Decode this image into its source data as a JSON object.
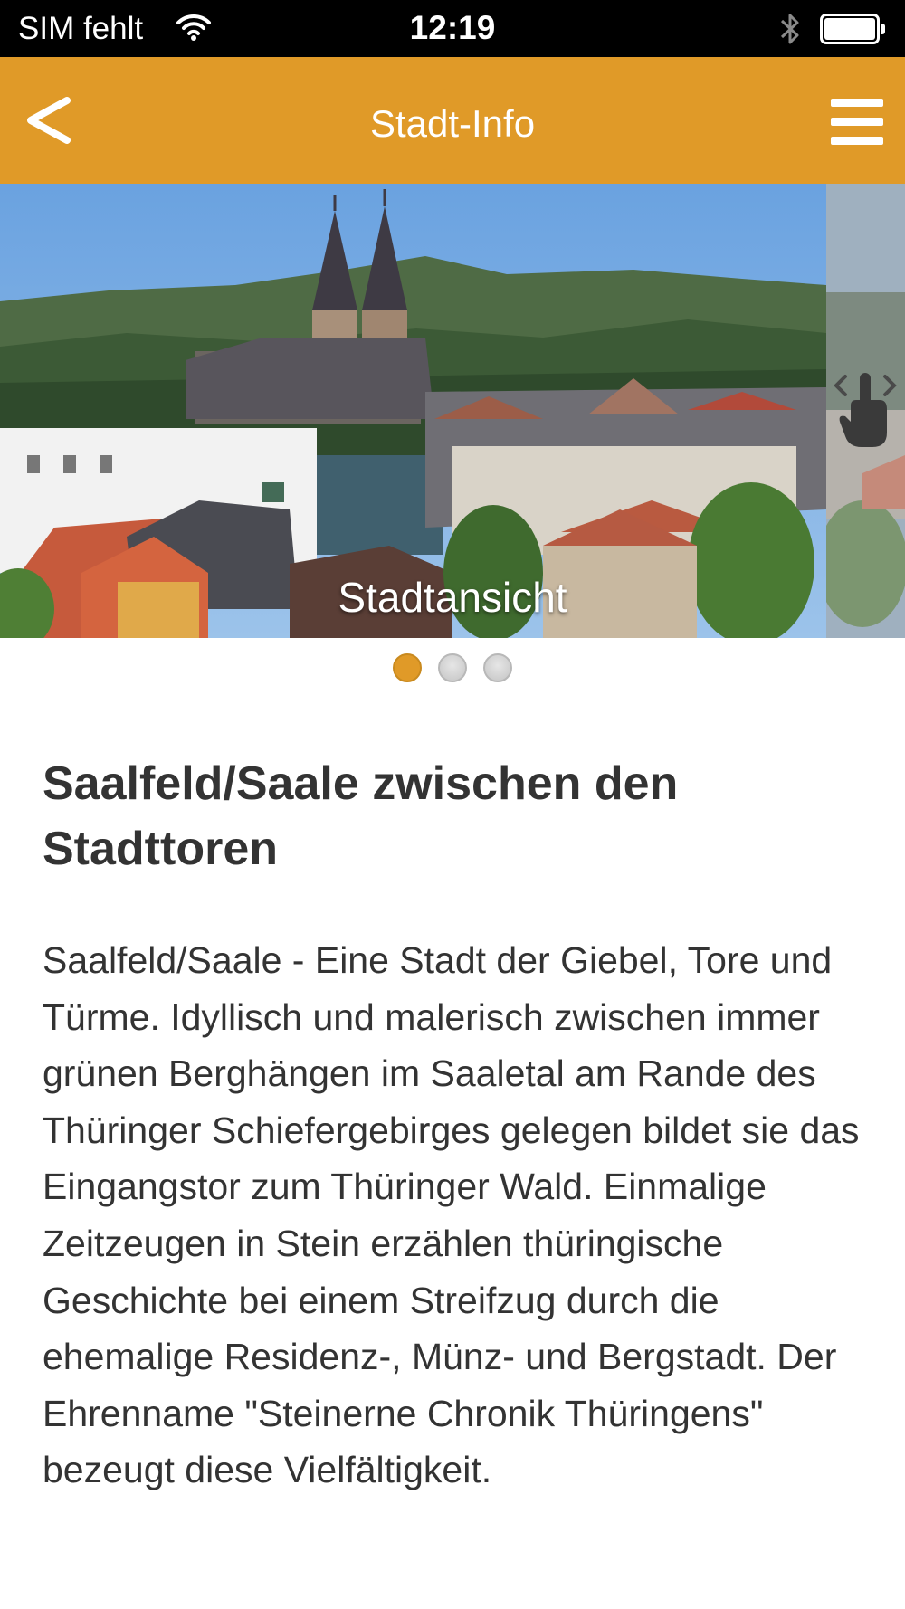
{
  "status_bar": {
    "carrier": "SIM fehlt",
    "time": "12:19",
    "icons": [
      "wifi-icon",
      "bluetooth-icon",
      "battery-icon"
    ]
  },
  "nav": {
    "title": "Stadt-Info",
    "back_icon": "chevron-left-icon",
    "menu_icon": "hamburger-menu-icon",
    "accent_color": "#e09a28"
  },
  "slider": {
    "caption": "Stadtansicht",
    "slide_count": 3,
    "active_index": 0,
    "swipe_hint_icon": "swipe-hand-icon"
  },
  "content": {
    "title": "Saalfeld/Saale zwischen den Stadttoren",
    "body": "Saalfeld/Saale - Eine Stadt der Giebel, Tore und Türme. Idyllisch und malerisch zwischen immer grünen Berghängen im Saaletal am Rande des Thüringer Schiefergebirges gelegen bildet sie das Eingangstor zum Thüringer Wald. Einmalige Zeitzeugen in Stein erzählen thüringische Geschichte bei einem Streifzug durch die ehemalige Residenz-, Münz- und Bergstadt. Der Ehrenname \"Steinerne Chronik Thüringens\" bezeugt diese Vielfältigkeit."
  }
}
